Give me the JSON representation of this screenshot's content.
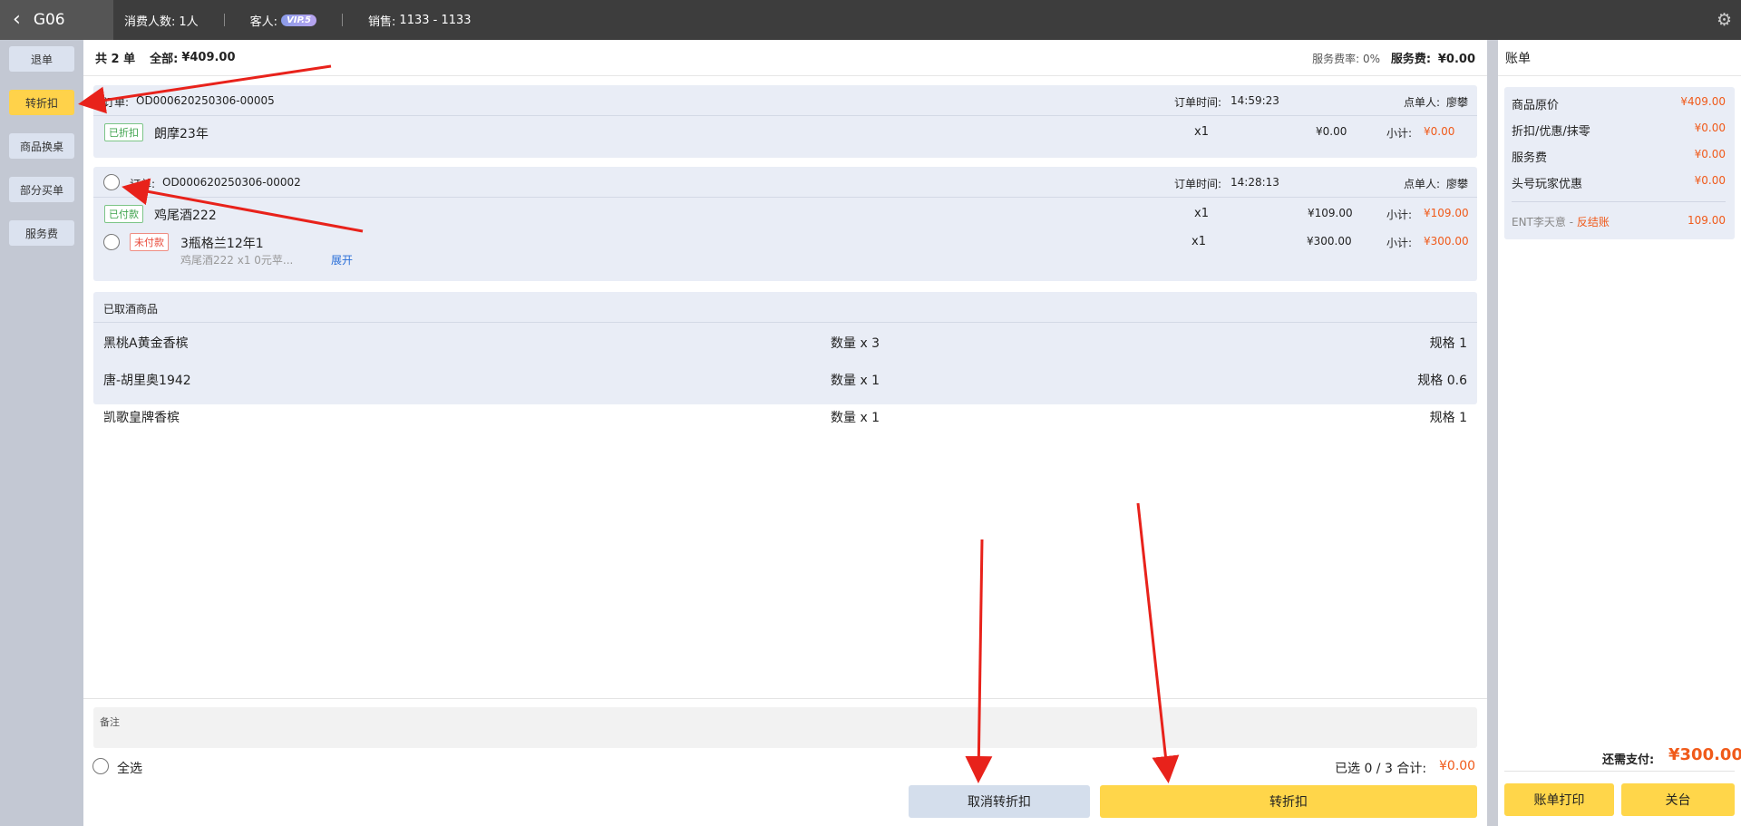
{
  "topbar": {
    "room": "G06",
    "guests_label": "消费人数:",
    "guests_value": "1人",
    "customer_label": "客人:",
    "vip_badge": "VIP.5",
    "sales_label": "销售:",
    "sales_value": "1133 - 1133"
  },
  "sidebar": {
    "items": [
      {
        "label": "退单"
      },
      {
        "label": "转折扣"
      },
      {
        "label": "商品换桌"
      },
      {
        "label": "部分买单"
      },
      {
        "label": "服务费"
      }
    ]
  },
  "summary": {
    "count_label": "共 2 单",
    "total_label": "全部:",
    "total_value": "¥409.00",
    "service_rate_label": "服务费率:",
    "service_rate_value": "0%",
    "service_fee_label": "服务费:",
    "service_fee_value": "¥0.00"
  },
  "orders": [
    {
      "order_label": "订单:",
      "order_no": "OD000620250306-00005",
      "time_label": "订单时间:",
      "time": "14:59:23",
      "staff_label": "点单人:",
      "staff": "廖攀",
      "items": [
        {
          "tag": "已折扣",
          "name": "朗摩23年",
          "qty": "x1",
          "price": "¥0.00",
          "subtotal_label": "小计:",
          "subtotal": "¥0.00"
        }
      ]
    },
    {
      "order_label": "订单:",
      "order_no": "OD000620250306-00002",
      "time_label": "订单时间:",
      "time": "14:28:13",
      "staff_label": "点单人:",
      "staff": "廖攀",
      "items": [
        {
          "tag": "已付款",
          "name": "鸡尾酒222",
          "qty": "x1",
          "price": "¥109.00",
          "subtotal_label": "小计:",
          "subtotal": "¥109.00"
        },
        {
          "tag": "未付款",
          "name": "3瓶格兰12年1",
          "sub": "鸡尾酒222 x1  0元苹...",
          "expand": "展开",
          "qty": "x1",
          "price": "¥300.00",
          "subtotal_label": "小计:",
          "subtotal": "¥300.00"
        }
      ]
    }
  ],
  "cancelled": {
    "title": "已取酒商品",
    "rows": [
      {
        "name": "黑桃A黄金香槟",
        "qty": "数量 x 3",
        "spec": "规格 1"
      },
      {
        "name": "唐-胡里奥1942",
        "qty": "数量 x 1",
        "spec": "规格 0.6"
      },
      {
        "name": "凯歌皇牌香槟",
        "qty": "数量 x 1",
        "spec": "规格 1"
      }
    ]
  },
  "footer": {
    "notes_label": "备注",
    "select_all": "全选",
    "selected_text": "已选 0 / 3 合计:",
    "selected_total": "¥0.00",
    "cancel_button": "取消转折扣",
    "confirm_button": "转折扣"
  },
  "bill": {
    "title": "账单",
    "rows": [
      {
        "label": "商品原价",
        "value": "¥409.00"
      },
      {
        "label": "折扣/优惠/抹零",
        "value": "¥0.00"
      },
      {
        "label": "服务费",
        "value": "¥0.00"
      },
      {
        "label": "头号玩家优惠",
        "value": "¥0.00"
      }
    ],
    "account_name": "ENT李天意 - ",
    "account_status": "反结账",
    "account_value": "109.00",
    "due_label": "还需支付:",
    "due_value": "¥300.00",
    "print_button": "账单打印",
    "close_button": "关台"
  },
  "colors": {
    "accent_yellow": "#ffd64a",
    "price_orange": "#f05a1a",
    "arrow_red": "#e8221b"
  }
}
